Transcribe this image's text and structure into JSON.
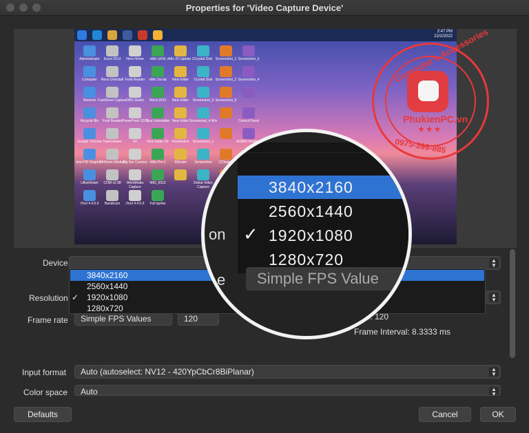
{
  "window": {
    "title": "Properties for 'Video Capture Device'"
  },
  "preview": {
    "clock_time": "2:47 PM",
    "clock_date": "22/2/2022",
    "desktop_icons": [
      "Administrator",
      "Excel 2013",
      "Nero Home",
      "vMix (x64)",
      "vMix 22 Update 1",
      "Crystal Disk",
      "Screenshot_1",
      "Screenshot_3",
      "Computer",
      "Revo Uninstall",
      "Foxit Reader",
      "vMix Social",
      "New folder",
      "Crystal Disk",
      "Screenshot_2",
      "Screenshot_4",
      "Network",
      "FastStone Capture",
      "OBS Studio",
      "Word 2013",
      "New folder",
      "Screenshot_5",
      "Screenshot_6",
      "",
      "Recycle Bin",
      "Foxit Reader",
      "PowerPoint 2013",
      "Your Uninstaller",
      "New folder",
      "Screenshot_4 Win",
      "",
      "Control Panel",
      "Google Chrome",
      "TeamViewer",
      "64",
      "New folder (4)",
      "FlowSwitch",
      "Screenshot_1",
      "",
      "AOMEI Partition",
      "Intel HD Graphics",
      "TVHome Media3",
      "Big Sur Cursors",
      "vMix Pro 2",
      "92testw",
      "Screenshot",
      "CCleaner",
      "iTunes",
      "UltraViewer",
      "COM v2.08",
      "AVerMedia Capture",
      "IMG_0012",
      "",
      "Debut Video Capture",
      "NCH Suite",
      "UniKey",
      "iTool 4.4.0.6",
      "Bandicam",
      "iTool 4.4.0.6",
      "Full Igofas"
    ]
  },
  "fields": {
    "device_label": "Device",
    "resolution_label": "Resolution",
    "frame_rate_label": "Frame rate",
    "frame_rate_mode": "Simple FPS Values",
    "frame_rate_value": "120",
    "fps_readout": "FPS: 120",
    "frame_interval": "Frame Interval: 8.3333 ms",
    "input_format_label": "Input format",
    "input_format_value": "Auto (autoselect: NV12 - 420YpCbCr8BiPlanar)",
    "color_space_label": "Color space",
    "color_space_value": "Auto"
  },
  "resolution_options": [
    "3840x2160",
    "2560x1440",
    "1920x1080",
    "1280x720"
  ],
  "highlighted_option": "3840x2160",
  "checked_option": "1920x1080",
  "checkmark": "✓",
  "magnifier": {
    "label_fragment": "on",
    "label_fragment_2": "e",
    "field_text": "Simple FPS Value"
  },
  "watermark": {
    "top_text": "Computer's Accessories",
    "brand": "PhukienPC.vn",
    "phone": "0975-398-885",
    "stars": "★ ★ ★"
  },
  "buttons": {
    "defaults": "Defaults",
    "cancel": "Cancel",
    "ok": "OK"
  },
  "colors": {
    "accent": "#2f73d2",
    "stamp": "#e8393b"
  }
}
